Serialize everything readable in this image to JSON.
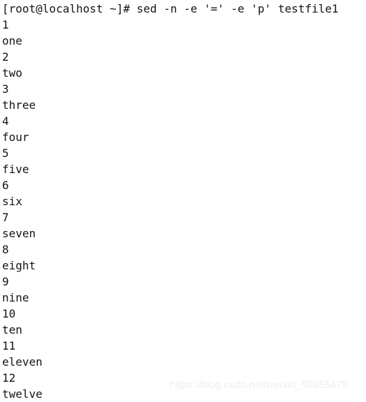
{
  "terminal": {
    "background_color": "#ffffff",
    "text_color": "#151515",
    "prompt_line": "[root@localhost ~]# sed -n -e '=' -e 'p' testfile1",
    "prompt": {
      "user": "root",
      "host": "localhost",
      "cwd": "~",
      "symbol": "#",
      "command": "sed -n -e '=' -e 'p' testfile1"
    },
    "output_lines": [
      "1",
      "one",
      "2",
      "two",
      "3",
      "three",
      "4",
      "four",
      "5",
      "five",
      "6",
      "six",
      "7",
      "seven",
      "8",
      "eight",
      "9",
      "nine",
      "10",
      "ten",
      "11",
      "eleven",
      "12",
      "twelve"
    ]
  },
  "watermark": {
    "text": "https://blog.csdn.net/weixin_50355475",
    "color": "#eeeeee"
  }
}
